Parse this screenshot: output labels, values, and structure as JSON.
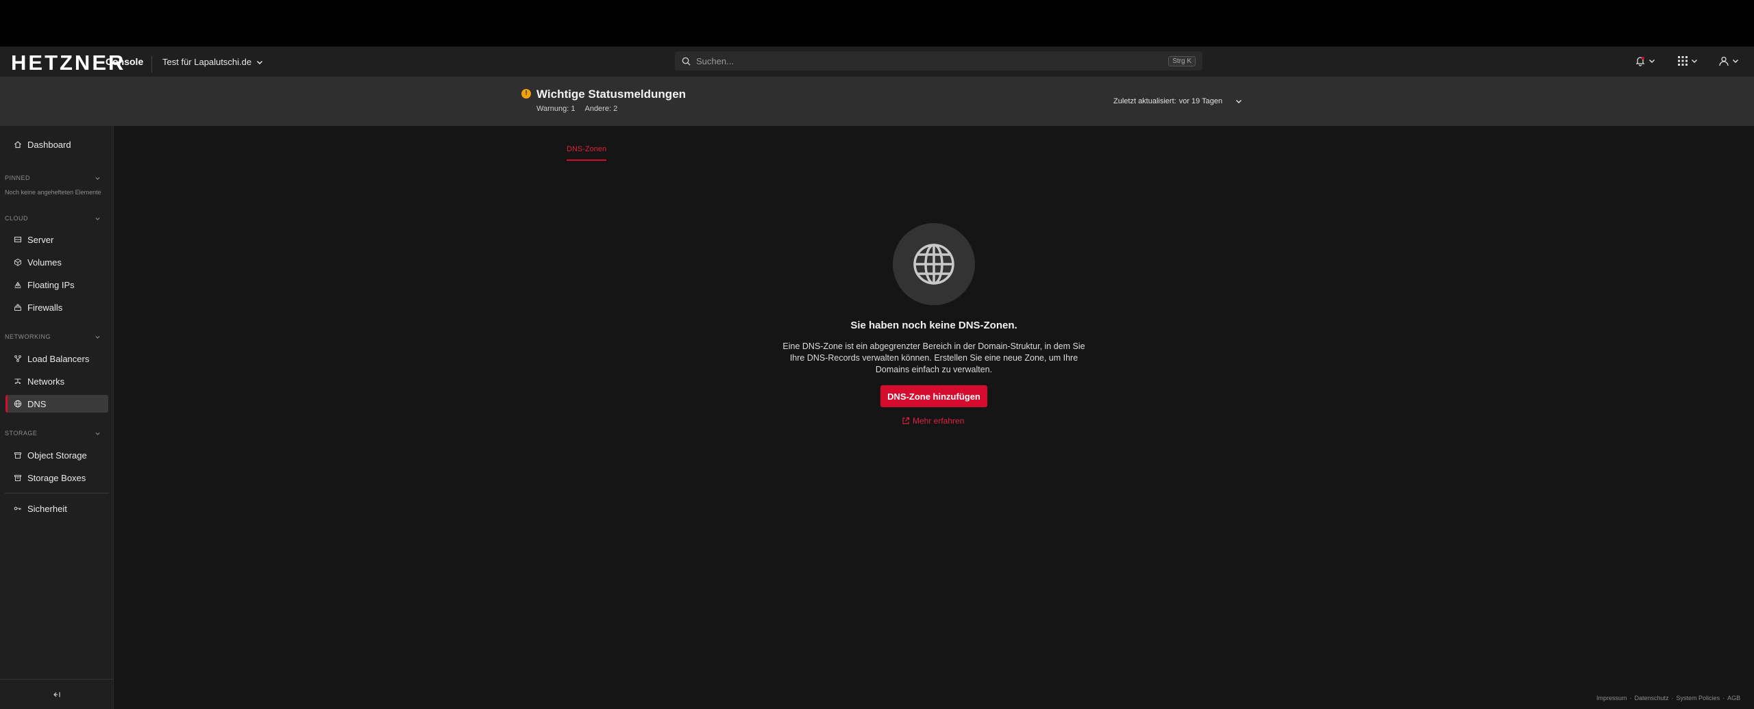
{
  "topbar": {
    "logo": "HETZNER",
    "product": "Console",
    "project": "Test für Lapalutschi.de",
    "search_placeholder": "Suchen...",
    "search_shortcut": "Strg K"
  },
  "status": {
    "title": "Wichtige Statusmeldungen",
    "warning_label": "Warnung:",
    "warning_count": "1",
    "other_label": "Andere:",
    "other_count": "2",
    "updated_label": "Zuletzt aktualisiert:",
    "updated_value": "vor 19 Tagen",
    "icon_color": "#f0a20a"
  },
  "sidebar": {
    "dashboard": "Dashboard",
    "pinned_header": "PINNED",
    "pinned_empty": "Noch keine angehefteten Elemente",
    "cloud_header": "CLOUD",
    "cloud_items": [
      "Server",
      "Volumes",
      "Floating IPs",
      "Firewalls"
    ],
    "networking_header": "NETWORKING",
    "networking_items": [
      "Load Balancers",
      "Networks",
      "DNS"
    ],
    "storage_header": "STORAGE",
    "storage_items": [
      "Object Storage",
      "Storage Boxes"
    ],
    "security": "Sicherheit",
    "active_item": "DNS"
  },
  "main": {
    "tab_label": "DNS-Zonen",
    "empty_title": "Sie haben noch keine DNS-Zonen.",
    "empty_description": "Eine DNS-Zone ist ein abgegrenzter Bereich in der Domain-Struktur, in dem Sie Ihre DNS-Records verwalten können. Erstellen Sie eine neue Zone, um Ihre Domains einfach zu verwalten.",
    "add_button": "DNS-Zone hinzufügen",
    "learn_more": "Mehr erfahren"
  },
  "footer": {
    "links": [
      "Impressum",
      "Datenschutz",
      "System Policies",
      "AGB"
    ]
  },
  "colors": {
    "accent": "#d50c2d",
    "background": "#151515",
    "sidebar": "#1f1f1f"
  }
}
